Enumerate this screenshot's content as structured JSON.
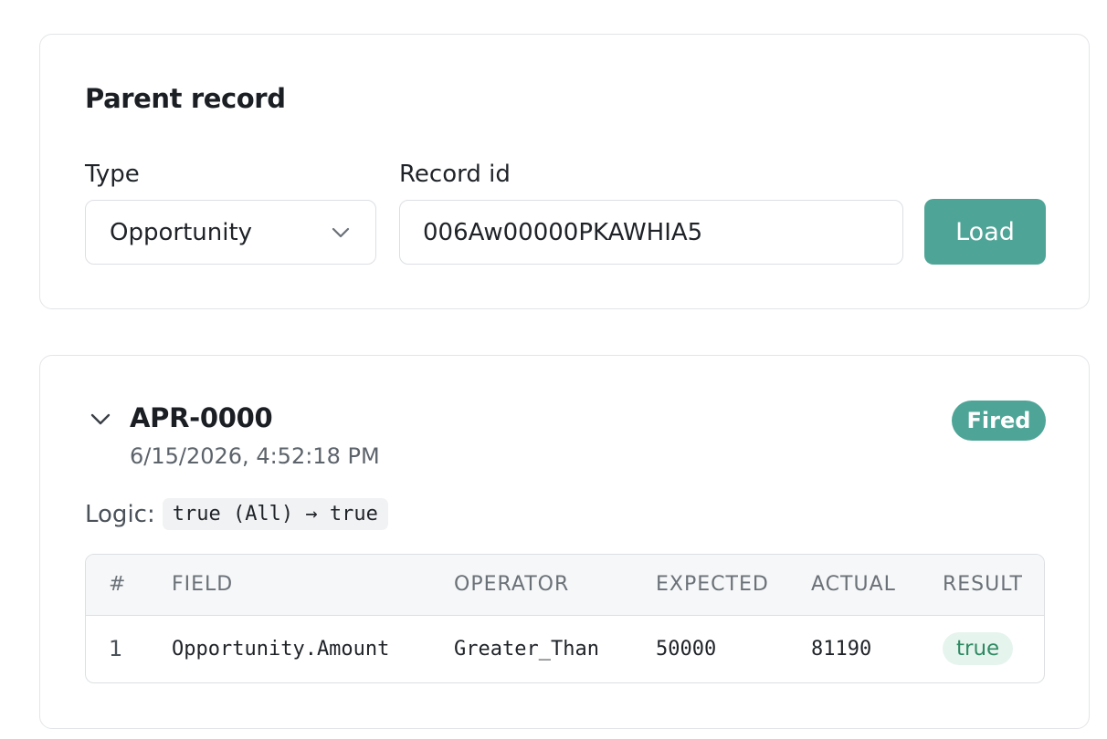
{
  "parent": {
    "title": "Parent record",
    "type_label": "Type",
    "type_value": "Opportunity",
    "record_label": "Record id",
    "record_value": "006Aw00000PKAWHIA5",
    "load_label": "Load"
  },
  "result": {
    "rule_id": "APR-0000",
    "timestamp": "6/15/2026, 4:52:18 PM",
    "status": "Fired",
    "logic_label": "Logic:",
    "logic_expr": "true (All) → true",
    "table": {
      "headers": [
        "#",
        "FIELD",
        "OPERATOR",
        "EXPECTED",
        "ACTUAL",
        "RESULT"
      ],
      "rows": [
        {
          "num": "1",
          "field": "Opportunity.Amount",
          "operator": "Greater_Than",
          "expected": "50000",
          "actual": "81190",
          "result": "true"
        }
      ]
    }
  },
  "colors": {
    "accent": "#4ea597",
    "result_true_bg": "#e6f4ee",
    "result_true_text": "#2f8a63"
  },
  "icons": {
    "select_chevron": "chevron-down-icon",
    "collapse_toggle": "chevron-down-icon"
  }
}
